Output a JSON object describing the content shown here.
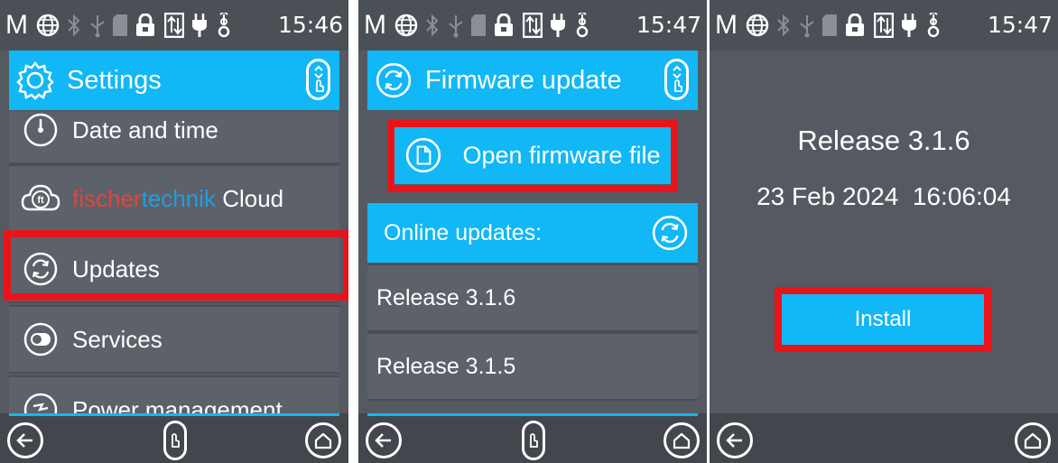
{
  "status_bar": {
    "clock_panel1": "15:46",
    "clock_panel2": "15:47",
    "clock_panel3": "15:47",
    "m_label": "M",
    "icons": [
      "m-icon",
      "globe-icon",
      "bluetooth-icon",
      "usb-icon",
      "sd-card-icon",
      "lock-icon",
      "transfer-icon",
      "power-plug-icon",
      "usb-device-icon"
    ]
  },
  "settings_screen": {
    "title": "Settings",
    "items": [
      {
        "label": "Date and time",
        "icon": "clock-icon"
      },
      {
        "label_part1": "fischer",
        "label_part2": "technik",
        "label_part3": " Cloud",
        "icon": "ft-cloud-icon"
      },
      {
        "label": "Updates",
        "icon": "refresh-icon"
      },
      {
        "label": "Services",
        "icon": "toggle-icon"
      },
      {
        "label": "Power management",
        "icon": "power-icon"
      }
    ],
    "highlighted": "Updates"
  },
  "firmware_screen": {
    "title": "Firmware update",
    "open_file_label": "Open firmware file",
    "online_updates_label": "Online updates:",
    "releases": [
      "Release 3.1.6",
      "Release 3.1.5"
    ]
  },
  "release_screen": {
    "release_name": "Release 3.1.6",
    "release_date": "23 Feb 2024",
    "release_time": "16:06:04",
    "install_label": "Install"
  },
  "colors": {
    "accent": "#12b7f5",
    "background": "#555a62",
    "highlight_box": "#e8141a",
    "brand_red": "#e2453b",
    "brand_blue": "#1e9fe0"
  }
}
